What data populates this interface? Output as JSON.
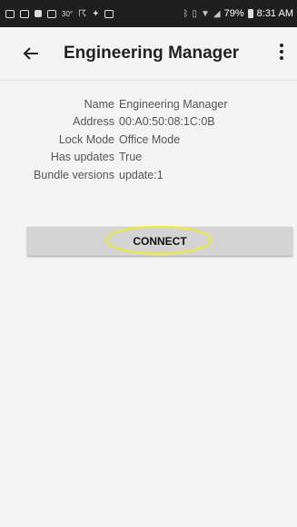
{
  "status_bar": {
    "battery": "79%",
    "time": "8:31 AM",
    "icons": [
      "message-icon",
      "gmail-icon",
      "photo-icon",
      "image-icon",
      "temperature-icon",
      "accessibility-icon",
      "puzzle-icon",
      "notes-icon",
      "bluetooth-icon",
      "vibrate-icon",
      "wifi-icon",
      "signal-icon",
      "battery-icon"
    ],
    "temperature": "30°"
  },
  "app_bar": {
    "title": "Engineering Manager"
  },
  "details": [
    {
      "label": "Name",
      "value": "Engineering Manager"
    },
    {
      "label": "Address",
      "value": "00:A0:50:08:1C:0B"
    },
    {
      "label": "Lock Mode",
      "value": "Office Mode"
    },
    {
      "label": "Has updates",
      "value": "True"
    },
    {
      "label": "Bundle versions",
      "value": "update:1"
    }
  ],
  "actions": {
    "connect_label": "CONNECT"
  },
  "colors": {
    "highlight": "#f2ee1f",
    "status_bar_bg": "#1f1f1f",
    "button_bg": "#d4d4d4"
  }
}
